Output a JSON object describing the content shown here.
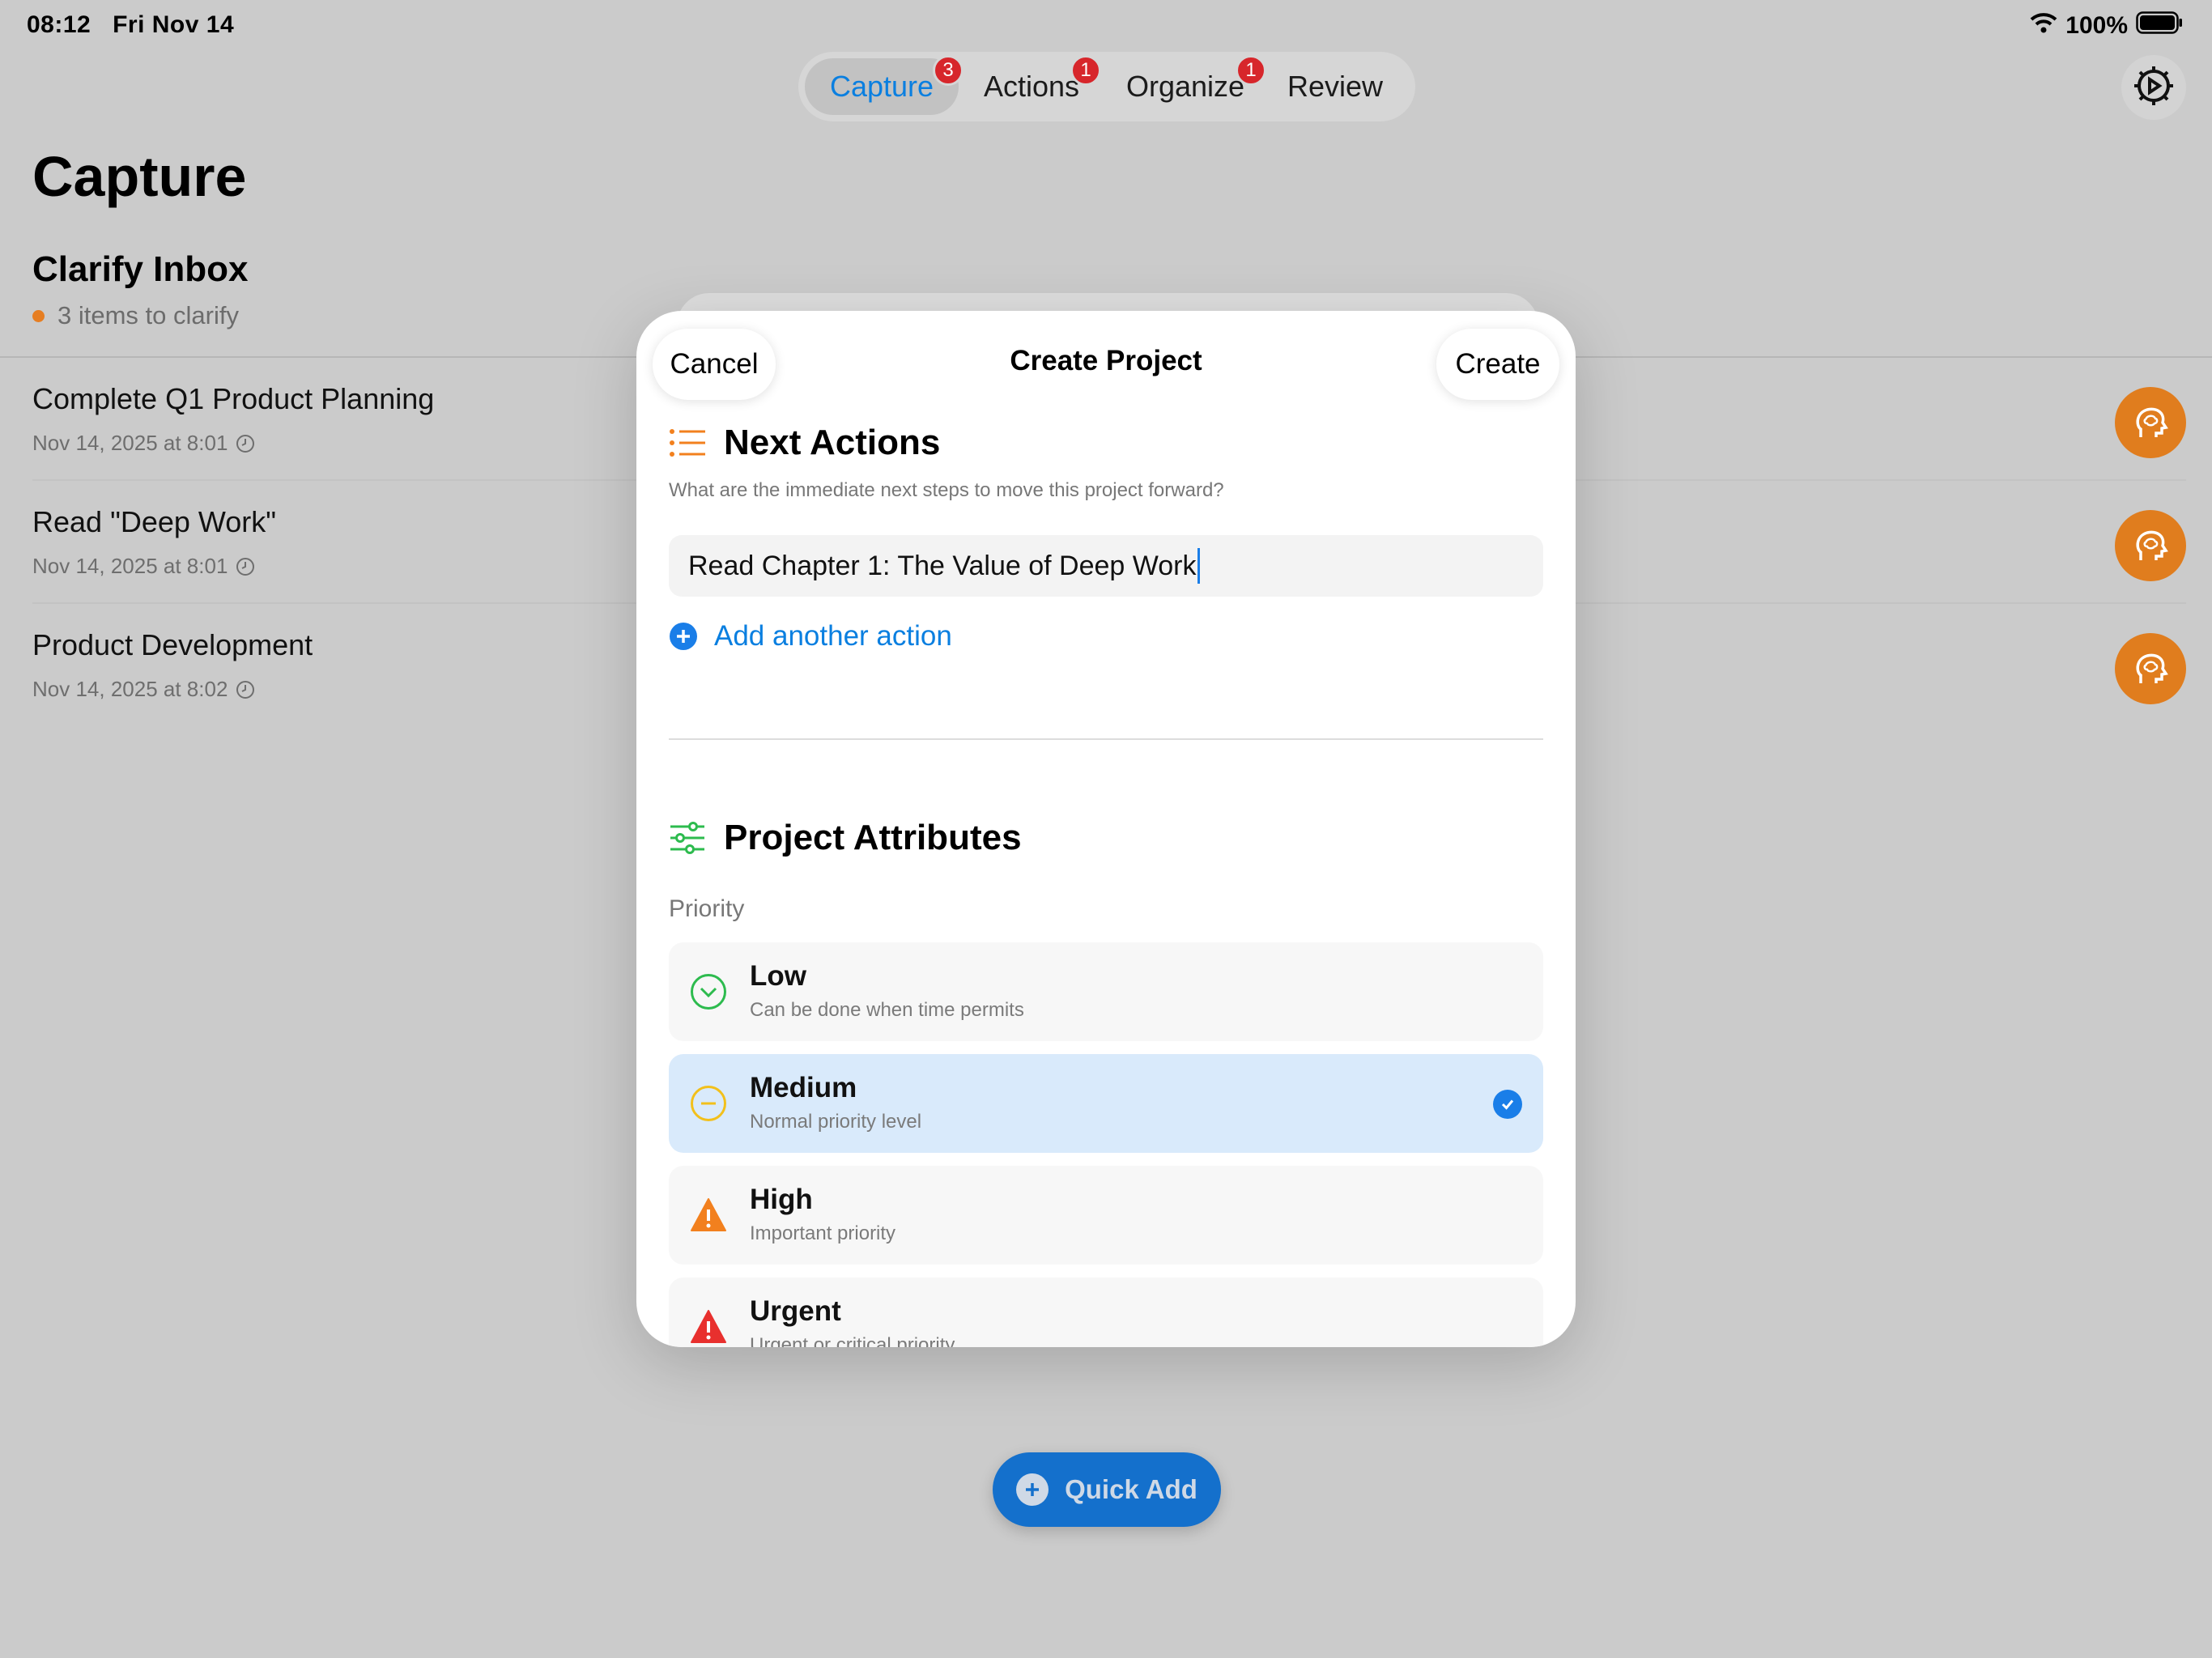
{
  "status_bar": {
    "time": "08:12",
    "date": "Fri Nov 14",
    "battery": "100%"
  },
  "tabs": [
    {
      "label": "Capture",
      "badge": "3",
      "active": true
    },
    {
      "label": "Actions",
      "badge": "1",
      "active": false
    },
    {
      "label": "Organize",
      "badge": "1",
      "active": false
    },
    {
      "label": "Review",
      "badge": "",
      "active": false
    }
  ],
  "page": {
    "title": "Capture",
    "inbox_title": "Clarify Inbox",
    "inbox_subtitle": "3 items to clarify"
  },
  "inbox_items": [
    {
      "title": "Complete Q1 Product Planning",
      "date": "Nov 14, 2025 at 8:01"
    },
    {
      "title": "Read \"Deep Work\"",
      "date": "Nov 14, 2025 at 8:01"
    },
    {
      "title": "Product Development",
      "date": "Nov 14, 2025 at 8:02"
    }
  ],
  "modal": {
    "cancel_label": "Cancel",
    "title": "Create Project",
    "create_label": "Create",
    "next_actions": {
      "heading": "Next Actions",
      "subtitle": "What are the immediate next steps to move this project forward?",
      "input_value": "Read Chapter 1: The Value of Deep Work",
      "add_label": "Add another action"
    },
    "attributes": {
      "heading": "Project Attributes",
      "priority_label": "Priority",
      "options": [
        {
          "title": "Low",
          "subtitle": "Can be done when time permits",
          "icon": "chevron-down-circle-icon",
          "color": "#2dbb4e"
        },
        {
          "title": "Medium",
          "subtitle": "Normal priority level",
          "icon": "minus-circle-icon",
          "color": "#f2c01b",
          "selected": true
        },
        {
          "title": "High",
          "subtitle": "Important priority",
          "icon": "warning-triangle-icon",
          "color": "#f2801e"
        },
        {
          "title": "Urgent",
          "subtitle": "Urgent or critical priority",
          "icon": "warning-triangle-icon",
          "color": "#e8302e"
        }
      ]
    }
  },
  "quick_add": {
    "label": "Quick Add"
  },
  "colors": {
    "accent": "#0a7fe0",
    "badge": "#d7262b",
    "clarify": "#e07d1e"
  }
}
